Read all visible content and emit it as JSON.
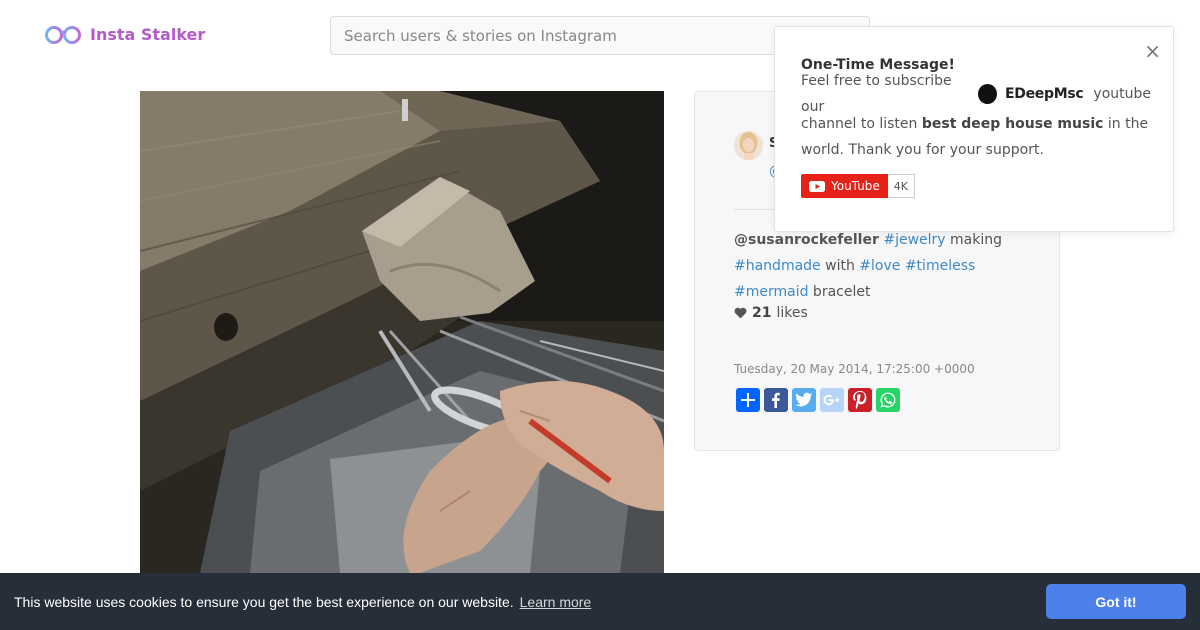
{
  "header": {
    "logo_text": "Insta Stalker",
    "search_placeholder": "Search users & stories on Instagram"
  },
  "post": {
    "user_name": "S",
    "user_handle": "@",
    "caption": {
      "mention": "@susanrockefeller",
      "tag_jewelry": "#jewelry",
      "text_making": " making",
      "tag_handmade": "#handmade",
      "text_with": " with ",
      "tag_love": "#love",
      "tag_timeless": "#timeless",
      "tag_mermaid": "#mermaid",
      "text_bracelet": " bracelet"
    },
    "likes_count": "21",
    "likes_label": "likes",
    "date": "Tuesday, 20 May 2014, 17:25:00 +0000",
    "share_buttons": [
      {
        "icon": "plus-icon",
        "color": "#0166ff"
      },
      {
        "icon": "facebook-icon",
        "color": "#3b5998"
      },
      {
        "icon": "twitter-icon",
        "color": "#55acee"
      },
      {
        "icon": "google-plus-icon",
        "color": "#b7d3f5"
      },
      {
        "icon": "pinterest-icon",
        "color": "#cb2027"
      },
      {
        "icon": "whatsapp-icon",
        "color": "#25d366"
      }
    ]
  },
  "popup": {
    "close": "×",
    "title": "One-Time Message!",
    "text_before": "Feel free to subscribe our",
    "channel_name": "EDeepMsc",
    "text_youtube": "youtube",
    "text_channel": "channel to listen ",
    "text_bold": "best deep house music",
    "text_in_the": " in the",
    "text_end": "world. Thank you for your support.",
    "yt_label": "YouTube",
    "yt_count": "4K"
  },
  "cookie": {
    "message": "This website uses cookies to ensure you get the best experience on our website.",
    "link": "Learn more",
    "button": "Got it!"
  }
}
